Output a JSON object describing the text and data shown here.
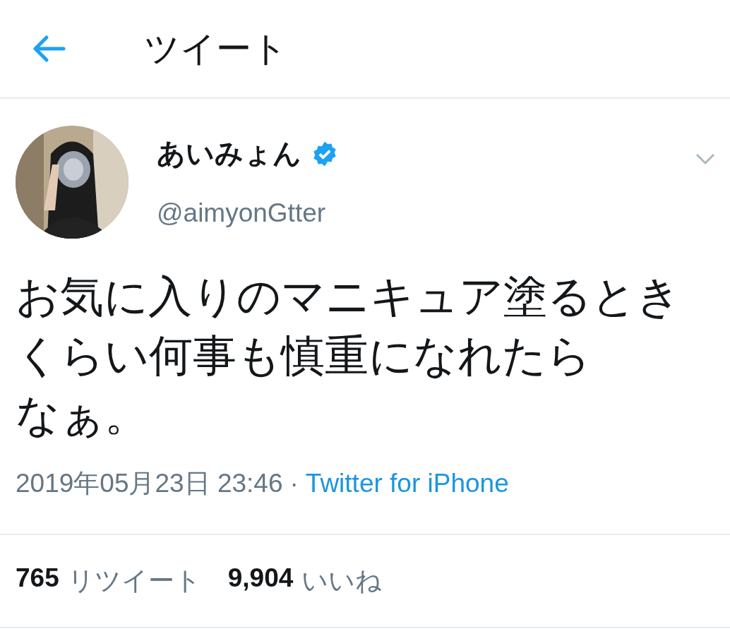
{
  "header": {
    "title": "ツイート"
  },
  "tweet": {
    "author": {
      "name": "あいみょん",
      "verified": true,
      "handle": "@aimyonGtter"
    },
    "text_lines": [
      "お気に入りのマニキュア塗るとき",
      "くらい何事も慎重になれたら",
      "なぁ。"
    ],
    "timestamp": "2019年05月23日 23:46",
    "separator": "·",
    "source": "Twitter for iPhone"
  },
  "stats": [
    {
      "count": "765",
      "label": "リツイート"
    },
    {
      "count": "9,904",
      "label": "いいね"
    }
  ]
}
